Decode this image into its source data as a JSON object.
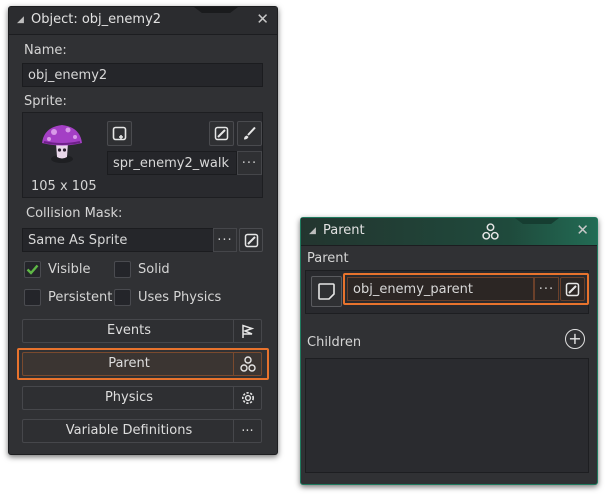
{
  "object_panel": {
    "title": "Object: obj_enemy2",
    "close_glyph": "✕",
    "name_label": "Name:",
    "name_value": "obj_enemy2",
    "sprite_label": "Sprite:",
    "sprite_name": "spr_enemy2_walk",
    "sprite_size": "105 x 105",
    "collision_label": "Collision Mask:",
    "collision_value": "Same As Sprite",
    "dots_label": "···",
    "checkboxes": {
      "visible": {
        "label": "Visible",
        "checked": true
      },
      "solid": {
        "label": "Solid",
        "checked": false
      },
      "persistent": {
        "label": "Persistent",
        "checked": false
      },
      "uses_physics": {
        "label": "Uses Physics",
        "checked": false
      }
    },
    "buttons": {
      "events": "Events",
      "parent": "Parent",
      "physics": "Physics",
      "variable_definitions": "Variable Definitions"
    },
    "icons": [
      "new-sprite-icon",
      "edit-sprite-icon",
      "brush-icon",
      "flag-icon",
      "parent-icon",
      "gear-icon",
      "mushroom-sprite-icon"
    ]
  },
  "parent_panel": {
    "title": "Parent",
    "close_glyph": "✕",
    "parent_label": "Parent",
    "parent_value": "obj_enemy_parent",
    "dots_label": "···",
    "children_label": "Children",
    "add_glyph": "+"
  },
  "colors": {
    "panel_bg": "#303134",
    "field_bg": "#25262a",
    "highlight": "#e8732d",
    "check_green": "#5fb846",
    "teal_border": "#1f7a5e"
  }
}
